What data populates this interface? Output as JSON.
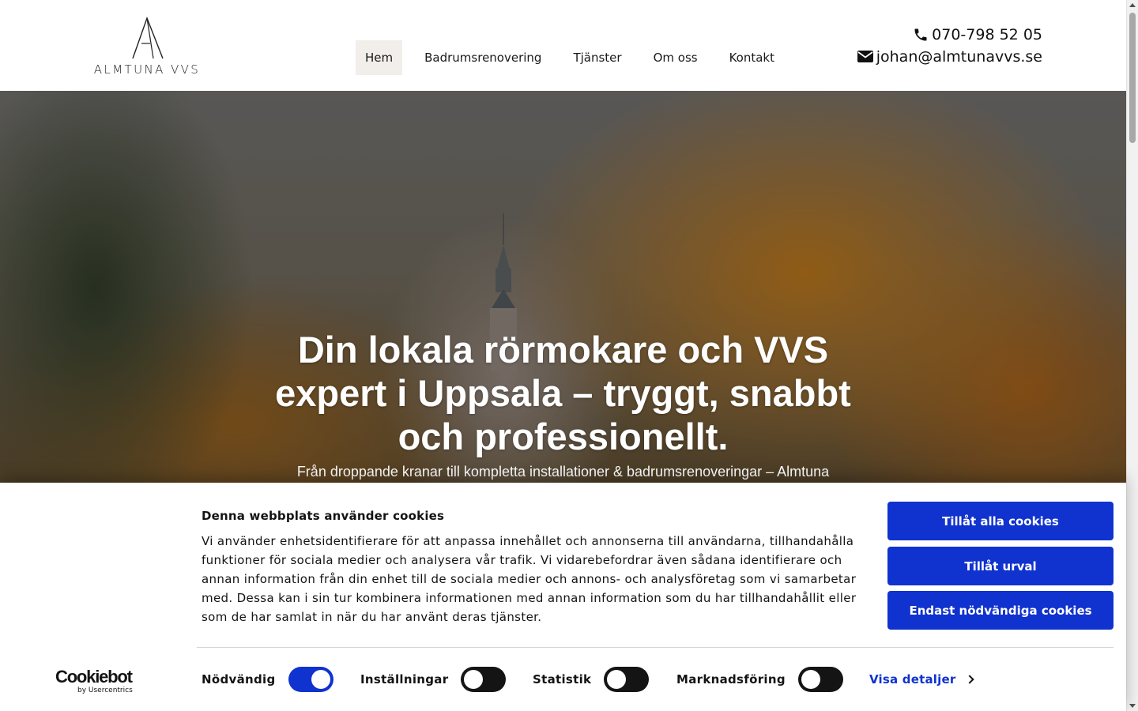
{
  "header": {
    "logo_text": "ALMTUNA VVS",
    "nav": [
      {
        "label": "Hem",
        "active": true
      },
      {
        "label": "Badrumsrenovering"
      },
      {
        "label": "Tjänster"
      },
      {
        "label": "Om oss"
      },
      {
        "label": "Kontakt"
      }
    ],
    "phone": {
      "icon": "phone-icon",
      "text": "070-798 52 05"
    },
    "email": {
      "icon": "envelope-icon",
      "text": "johan@almtunavvs.se"
    }
  },
  "hero": {
    "title": "Din lokala rörmokare och VVS expert i Uppsala – tryggt, snabbt och professionellt.",
    "subtitle": "Från droppande kranar till kompletta installationer & badrumsrenoveringar – Almtuna"
  },
  "cookie_banner": {
    "title": "Denna webbplats använder cookies",
    "text": "Vi använder enhetsidentifierare för att anpassa innehållet och annonserna till användarna, tillhandahålla funktioner för sociala medier och analysera vår trafik. Vi vidarebefordrar även sådana identifierare och annan information från din enhet till de sociala medier och annons- och analysföretag som vi samarbetar med. Dessa kan i sin tur kombinera informationen med annan information som du har tillhandahållit eller som de har samlat in när du har använt deras tjänster.",
    "buttons": {
      "allow_all": "Tillåt alla cookies",
      "allow_selection": "Tillåt urval",
      "necessary_only": "Endast nödvändiga cookies"
    },
    "toggles": [
      {
        "label": "Nödvändig",
        "on": true
      },
      {
        "label": "Inställningar",
        "on": false
      },
      {
        "label": "Statistik",
        "on": false
      },
      {
        "label": "Marknadsföring",
        "on": false
      }
    ],
    "details_link": "Visa detaljer",
    "brand": {
      "name": "Cookiebot",
      "sub": "by Usercentrics"
    },
    "accent_color": "#1032cf"
  }
}
